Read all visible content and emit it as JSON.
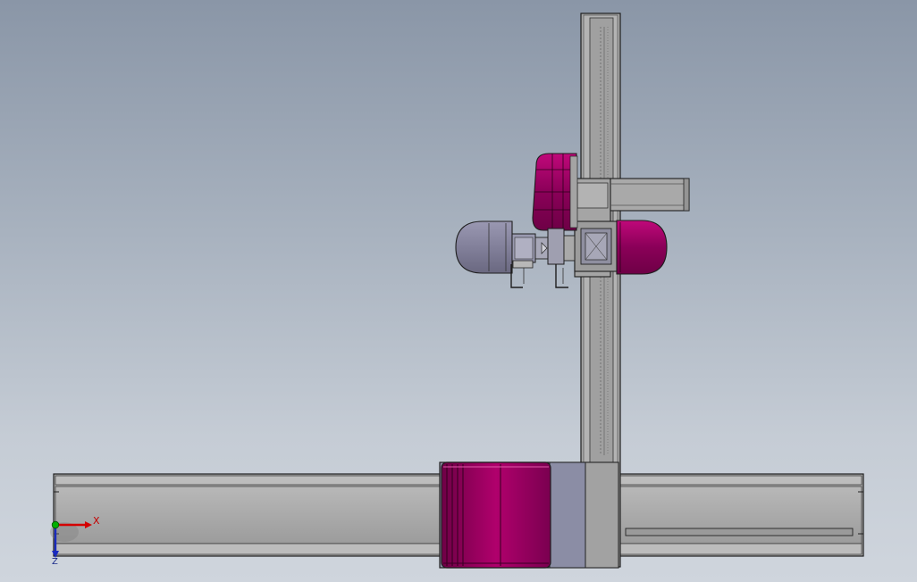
{
  "triad": {
    "x_label": "X",
    "z_label": "Z",
    "x_color": "#d40000",
    "y_color": "#00b000",
    "z_color": "#1a2bbf"
  },
  "colors": {
    "background_top": "#8a96a7",
    "background_bottom": "#cfd5dd",
    "rail": "#a8a8a8",
    "rail_dark": "#8e8e8e",
    "housing": "#7b0050",
    "housing_light": "#b5006f",
    "metal_blue": "#8c8fa3",
    "edge": "#1e1e1e"
  }
}
